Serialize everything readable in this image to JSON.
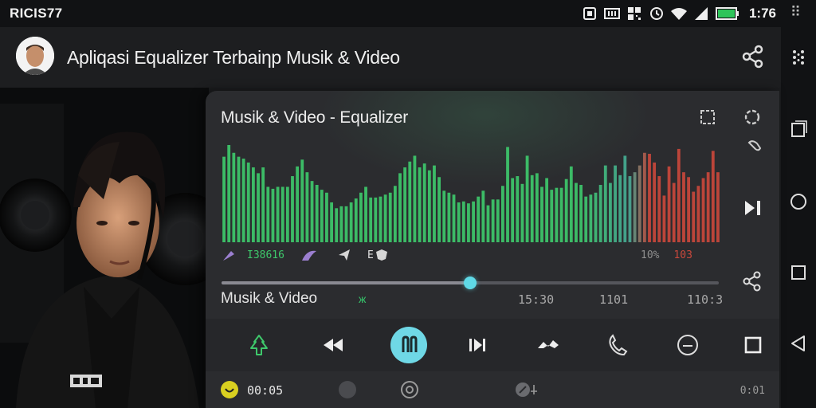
{
  "status_bar": {
    "carrier": "RICIS77",
    "clock": "1:76",
    "icons": [
      "sim-icon",
      "data-icon",
      "qr-icon",
      "alarm-icon",
      "wifi-icon",
      "signal-icon",
      "battery-icon"
    ]
  },
  "header": {
    "title": "Apliqasi Equalizer Terbaiηp Musik & Video",
    "avatar": "avatar"
  },
  "player": {
    "title": "Musik & Video - Equalizer",
    "mini_label_left": "I38616",
    "mini_label_mid": "E",
    "mini_pct": "10%",
    "mini_level": "103",
    "track_name": "Musik & Video",
    "t_mark": "ж",
    "time_1": "15:30",
    "time_2": "1101",
    "time_3": "110:3",
    "elapsed": "00:05",
    "end_label": "0:01",
    "progress": 0.5
  },
  "colors": {
    "accent": "#6fd8e6",
    "green": "#3ec86b",
    "red": "#c9483c",
    "lavender": "#9b7fd0"
  },
  "chart_data": {
    "type": "bar",
    "values": [
      88,
      100,
      92,
      88,
      86,
      82,
      77,
      71,
      77,
      57,
      55,
      57,
      57,
      57,
      68,
      78,
      85,
      72,
      63,
      59,
      54,
      51,
      41,
      35,
      37,
      37,
      41,
      45,
      51,
      57,
      46,
      46,
      47,
      49,
      51,
      58,
      71,
      77,
      83,
      89,
      77,
      81,
      74,
      79,
      67,
      53,
      51,
      49,
      41,
      42,
      40,
      42,
      47,
      53,
      38,
      44,
      44,
      58,
      98,
      66,
      68,
      60,
      89,
      69,
      71,
      57,
      66,
      54,
      56,
      56,
      65,
      78,
      61,
      59,
      47,
      49,
      51,
      59,
      79,
      61,
      79,
      69,
      89,
      68,
      72,
      79,
      92,
      91,
      82,
      68,
      48,
      78,
      61,
      96,
      72,
      67,
      52,
      58,
      66,
      72,
      94,
      72
    ]
  }
}
